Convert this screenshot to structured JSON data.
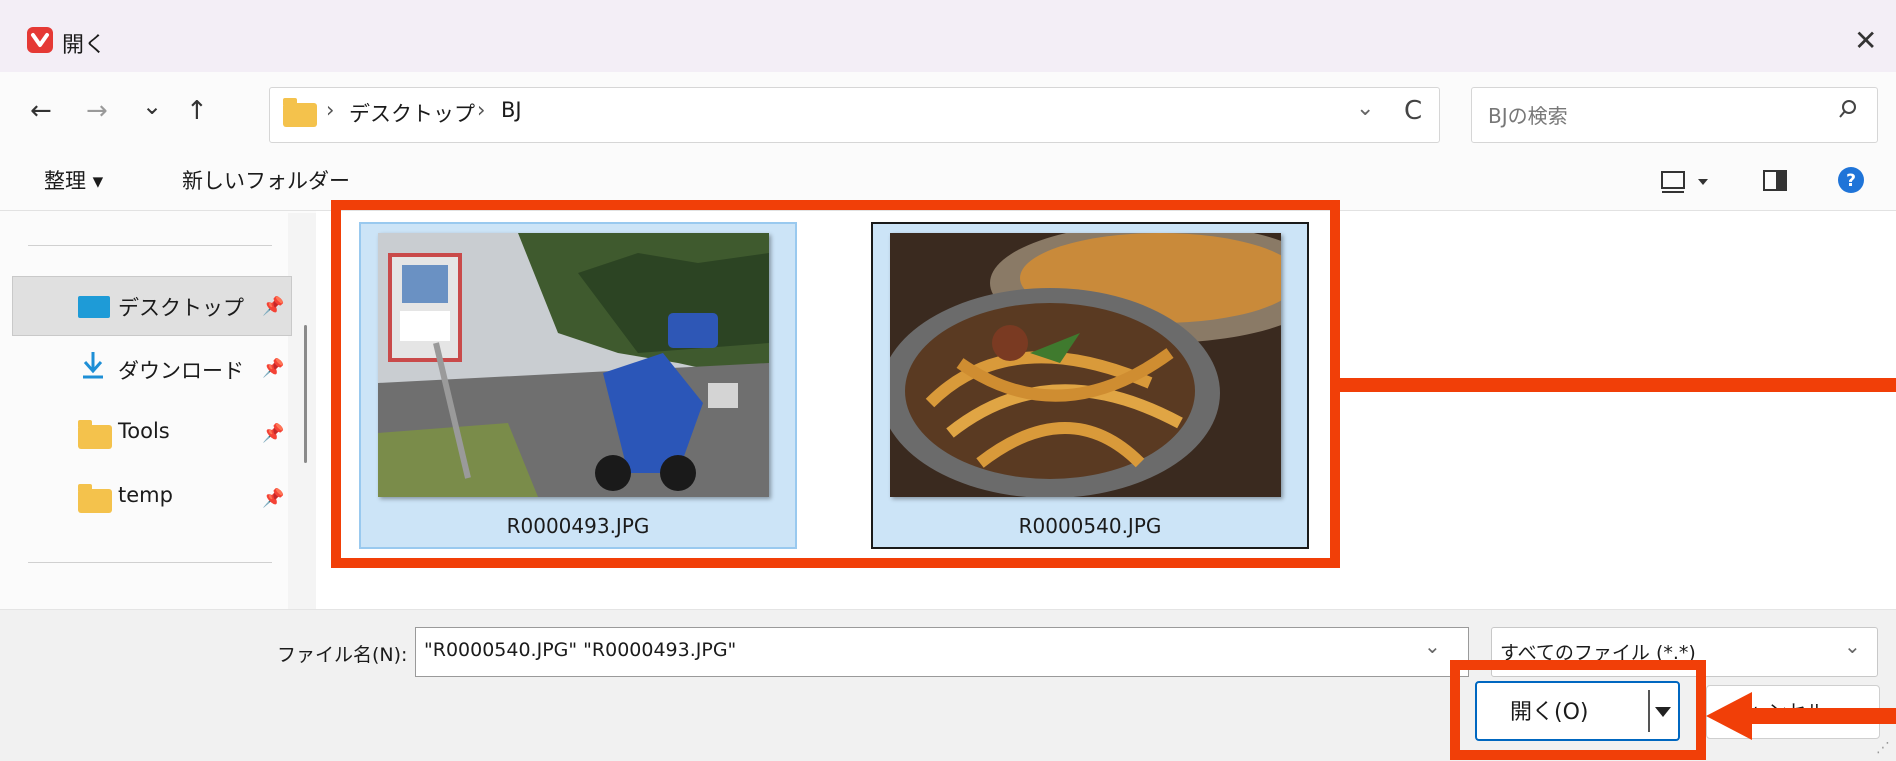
{
  "window": {
    "title": "開く",
    "close_glyph": "✕"
  },
  "nav": {
    "back": "←",
    "forward": "→",
    "recent": "⌄",
    "up": "↑",
    "dropdown": "⌄",
    "refresh": "C"
  },
  "breadcrumb": {
    "items": [
      "デスクトップ",
      "BJ"
    ],
    "separator": "›"
  },
  "search": {
    "placeholder": "BJの検索"
  },
  "toolbar": {
    "organize_label": "整理 ▾",
    "new_folder_label": "新しいフォルダー"
  },
  "sidebar": {
    "items": [
      {
        "label": "デスクトップ",
        "icon": "desktop-icon",
        "selected": true
      },
      {
        "label": "ダウンロード",
        "icon": "download-icon"
      },
      {
        "label": "Tools",
        "icon": "folder-icon"
      },
      {
        "label": "temp",
        "icon": "folder-icon"
      }
    ]
  },
  "files": [
    {
      "name": "R0000493.JPG",
      "selected": true,
      "focused": false
    },
    {
      "name": "R0000540.JPG",
      "selected": true,
      "focused": true
    }
  ],
  "bottom": {
    "filename_label": "ファイル名(N):",
    "filename_value": "\"R0000540.JPG\" \"R0000493.JPG\"",
    "filetype_value": "すべてのファイル (*.*)",
    "open_label": "開く(O)",
    "cancel_label": "キャンセル"
  },
  "colors": {
    "annotation": "#f13f08",
    "selection": "#cce4f7",
    "accent": "#0067c0"
  }
}
